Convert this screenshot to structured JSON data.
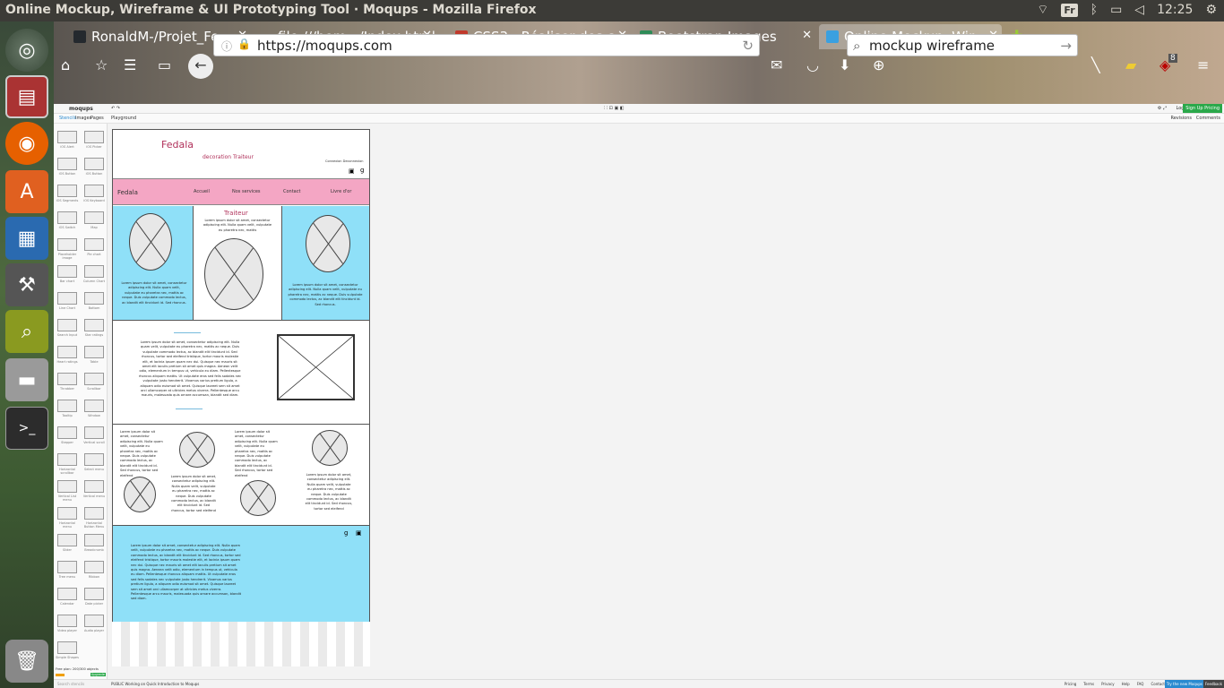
{
  "system": {
    "window_title": "Online Mockup, Wireframe & UI Prototyping Tool · Moqups - Mozilla Firefox",
    "lang": "Fr",
    "clock": "12:25"
  },
  "tabs": [
    {
      "label": "RonaldM-/Projet_Fe...",
      "color": "#24292e"
    },
    {
      "label": "file:///hom.../Index.html",
      "color": "#888888"
    },
    {
      "label": "CSS3 : Réaliser des c...",
      "color": "#c0392b"
    },
    {
      "label": "Bootstrap Images",
      "color": "#2e8b57"
    },
    {
      "label": "Online Mockup, Wir...",
      "color": "#3aa0e0"
    }
  ],
  "urlbar": {
    "url": "https://moqups.com"
  },
  "search": {
    "value": "mockup wireframe"
  },
  "badge": {
    "count": "8"
  },
  "moqups": {
    "logo": "moqups",
    "toolbar_right": [
      "Login",
      "Sign Up Pricing"
    ],
    "panel_tabs": [
      "Stencils",
      "Images",
      "Pages"
    ],
    "playground": "Playground",
    "revisions": "Revisions",
    "comments": "Comments",
    "plan": "Free plan: 200/300 objects",
    "upgrade": "Upgrade",
    "search_stencils": "Search stencils",
    "status": "PUBLIC  Working on Quick Introduction to Moqups",
    "footer_links": [
      "Pricing",
      "Terms",
      "Privacy",
      "Help",
      "FAQ",
      "Contact"
    ],
    "try_btn": "Try the new Moqups",
    "feedback": "Feedback",
    "stencils": [
      "iOS Alert",
      "iOS Picker",
      "iOS Button",
      "iOS Button",
      "iOS Segments",
      "iOS Keyboard",
      "iOS Switch",
      "Map",
      "Placeholder image",
      "Pie chart",
      "Bar chart",
      "Column Chart",
      "Line Chart",
      "Bottom",
      "Search Input",
      "Star ratings",
      "Heart ratings",
      "Table",
      "Throbber",
      "Scrollbar",
      "Tooltip",
      "Window",
      "Stepper",
      "Vertical scroll",
      "Horizontal scrollbar",
      "Select menu",
      "Vertical List menu",
      "Vertical menu",
      "Horizontal menu",
      "Horizontal Button Menu",
      "Slider",
      "Breadcrumb",
      "Tree menu",
      "Ribbon",
      "Calendar",
      "Date picker",
      "Video player",
      "Audio player",
      "Simple Shapes"
    ]
  },
  "mockpage": {
    "brand": "Fedala",
    "tagline": "decoration   Traiteur",
    "login": "Connexion Deconnexion",
    "nav": [
      "Fedala",
      "Accueil",
      "Nos services",
      "Contact",
      "Livre d'or"
    ],
    "section_title": "Traiteur",
    "lorem_short": "Lorem ipsum dolor sit amet, consectetur adipiscing elit. Nulla quam velit, vulputate eu pharetra nec, mattis ac neque. Duis vulputate commodo lectus, ac blandit elit tincidunt id. Sed rhoncus.",
    "lorem_mid": "Lorem ipsum dolor sit amet, consectetur adipiscing elit. Nulla quam velit, vulputate eu pharetra nec, mattis",
    "lorem_long": "Lorem ipsum dolor sit amet, consectetur adipiscing elit. Nulla quam velit, vulputate eu pharetra nec, mattis ac neque. Duis vulputate commodo lectus, ac blandit elit tincidunt id. Sed rhoncus, tortor sed eleifend tristique, tortor mauris molestie elit, et lacinia ipsum quam nec dui. Quisque nec mauris sit amet elit iaculis pretium sit amet quis magna. Aenean velit odio, elementum in tempus ut, vehicula eu diam. Pellentesque rhoncus aliquam mattis. Ut vulputate eros sed felis sodales nec vulputate justo hendrerit. Vivamus varius pretium ligula, a aliquam odio euismod sit amet. Quisque laoreet sem sit amet orci ullamcorper at ultricies metus viverra. Pellentesque arcu mauris, malesuada quis ornare accumsan, blandit sed diam.",
    "lorem_col": "Lorem ipsum dolor sit amet, consectetur adipiscing elit. Nulla quam velit, vulputate eu pharetra nec, mattis ac neque. Duis vulputate commodo lectus, ac blandit elit tincidunt id. Sed rhoncus, tortor sed eleifend"
  }
}
